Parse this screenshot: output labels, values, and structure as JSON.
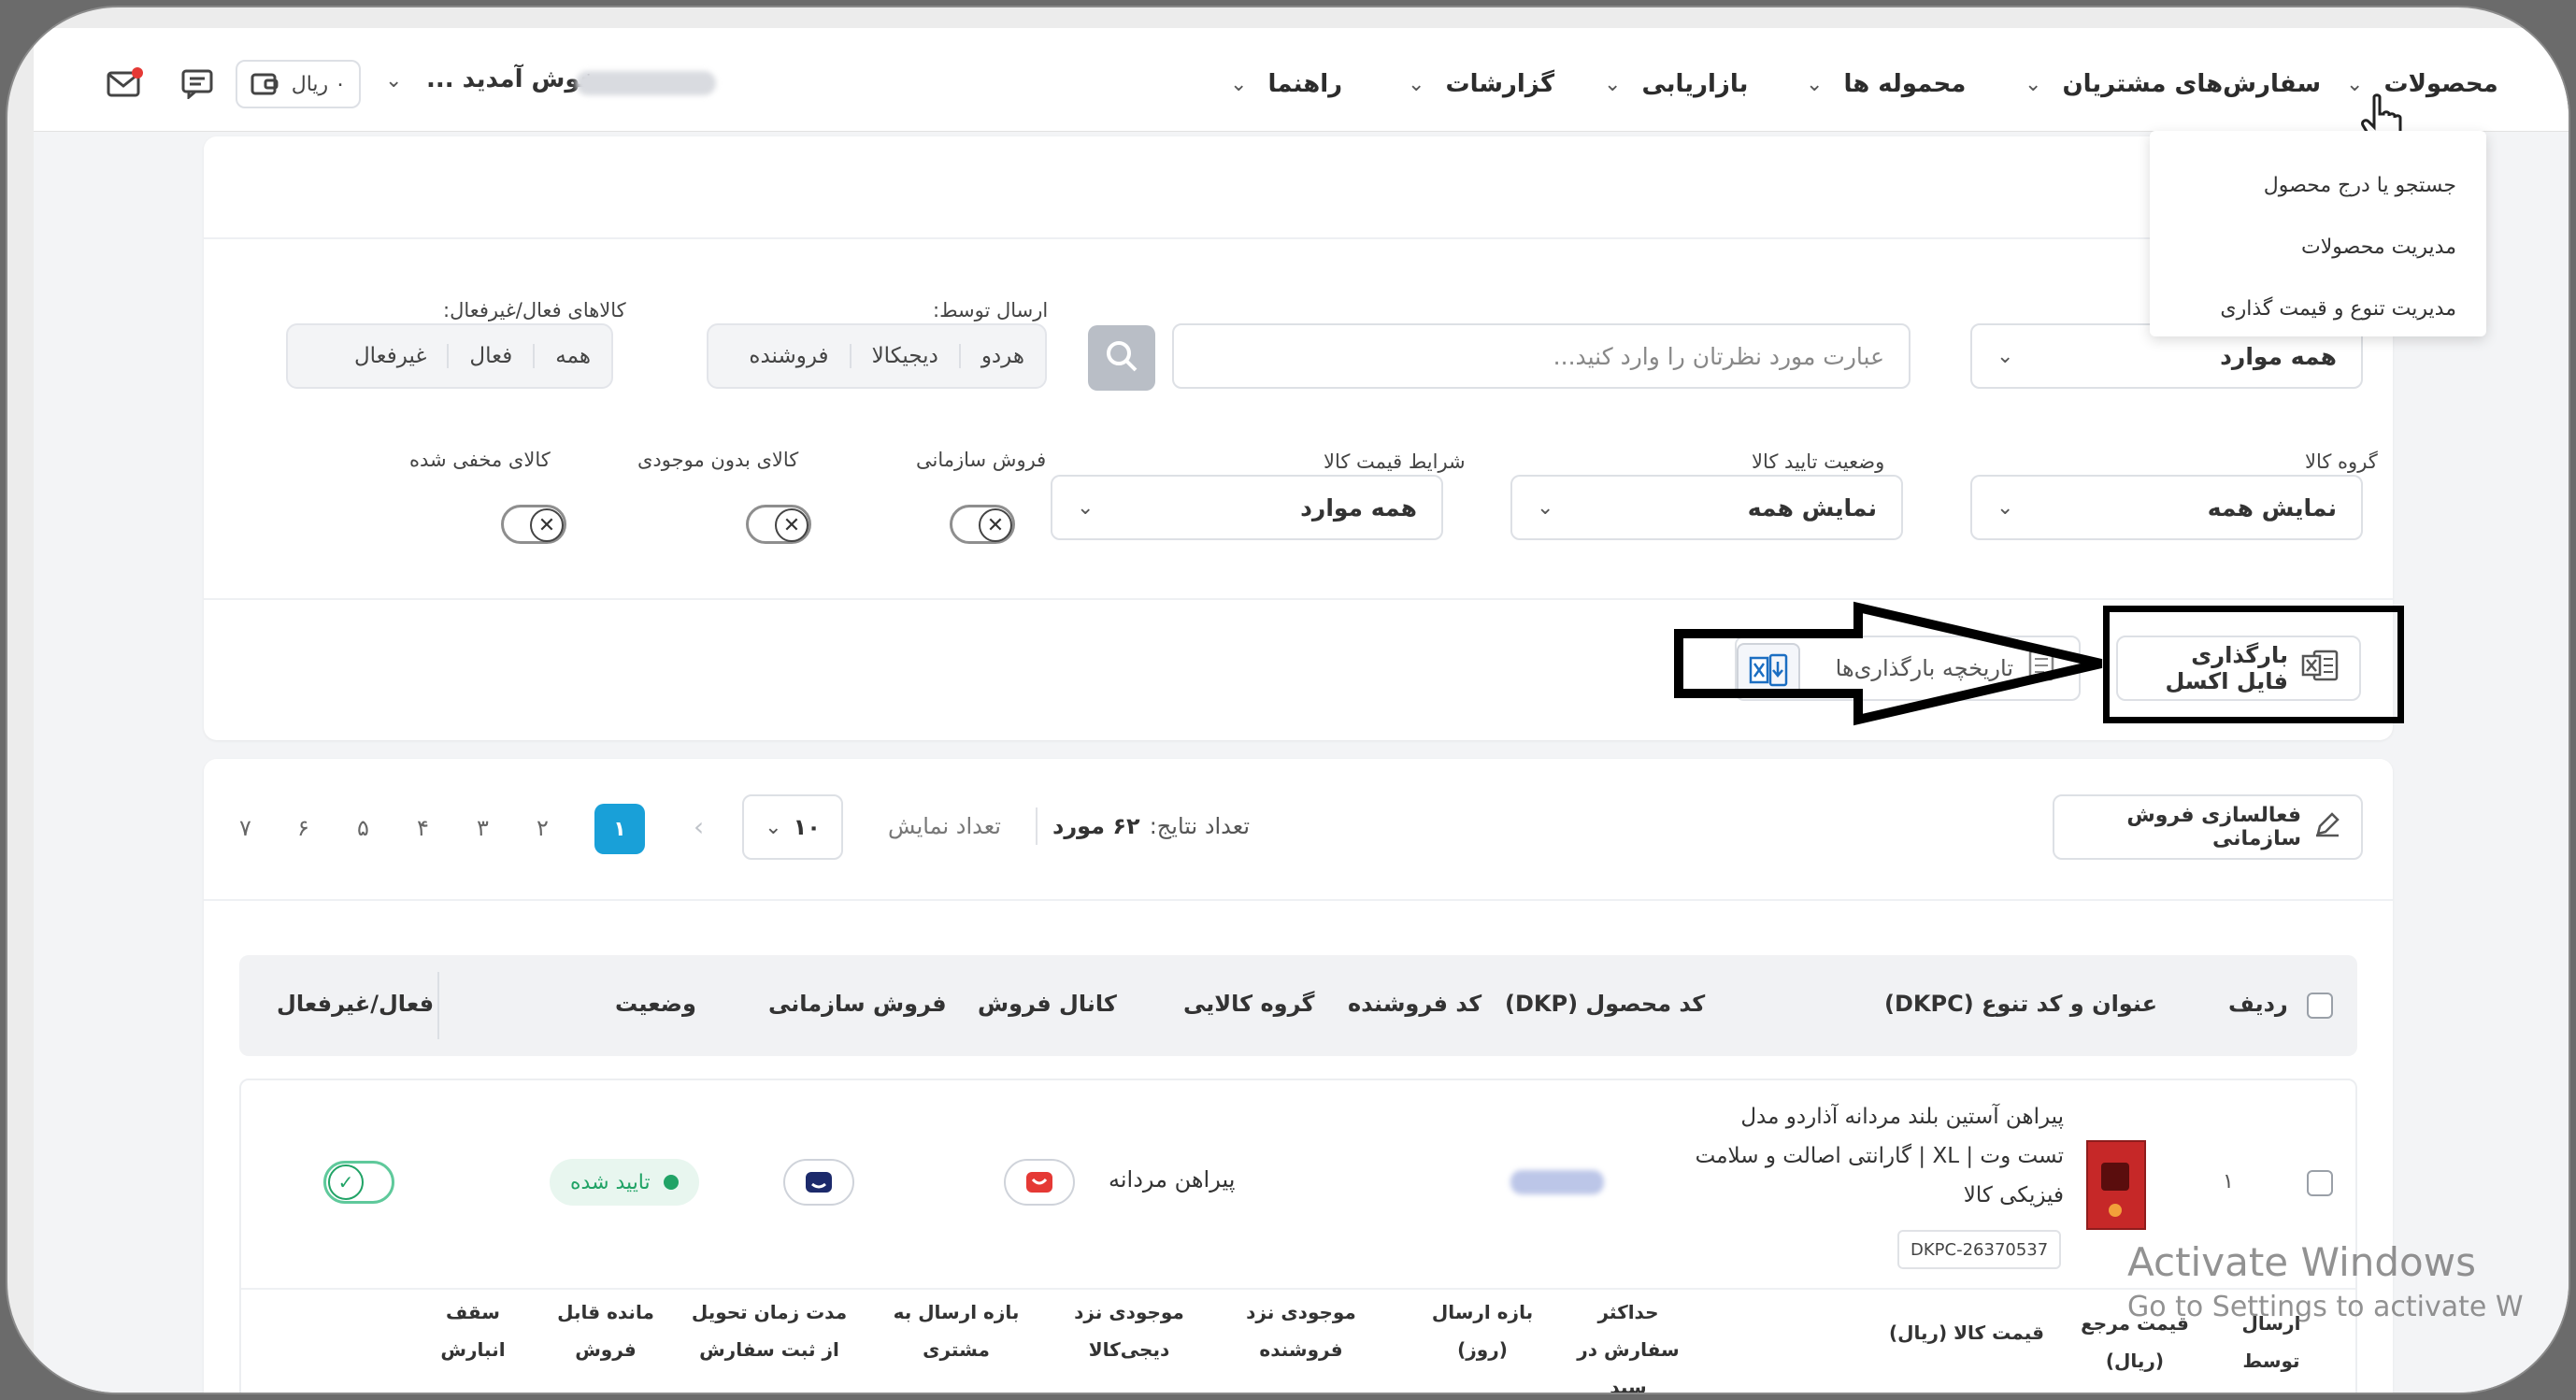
{
  "topbar": {
    "nav": [
      {
        "label": "محصولات"
      },
      {
        "label": "سفارش‌های مشتریان"
      },
      {
        "label": "محموله ها"
      },
      {
        "label": "بازاریابی"
      },
      {
        "label": "گزارشات"
      },
      {
        "label": "راهنما"
      }
    ],
    "welcome": "خوش آمدید ...",
    "balance": "۰ ریال"
  },
  "dropdown_menu": {
    "items": [
      "جستجو یا درج محصول",
      "مدیریت محصولات",
      "مدیریت تنوع و قیمت گذاری"
    ]
  },
  "filters": {
    "search_scope": "همه موارد",
    "search_placeholder": "عبارت مورد نظرتان را وارد کنید...",
    "sent_by_label": "ارسال توسط:",
    "sent_by_options": [
      "هردو",
      "دیجیکالا",
      "فروشنده"
    ],
    "active_label": "کالاهای فعال/غیرفعال:",
    "active_options": [
      "همه",
      "فعال",
      "غیرفعال"
    ],
    "product_group_label": "گروه کالا",
    "product_group_value": "نمایش همه",
    "approval_status_label": "وضعیت تایید کالا",
    "approval_status_value": "نمایش همه",
    "price_condition_label": "شرایط قیمت کالا",
    "price_condition_value": "همه موارد",
    "org_sale_label": "فروش سازمانی",
    "no_stock_label": "کالای بدون موجودی",
    "hidden_label": "کالای مخفی شده"
  },
  "actions": {
    "upload_excel": "بارگذاری فایل اکسل",
    "upload_history": "تاریخچه بارگذاری‌ها"
  },
  "results": {
    "activate_org_sale": "فعالسازی فروش سازمانی",
    "count_label": "تعداد نتایج:",
    "count_value": "۶۲ مورد",
    "per_page_label": "تعداد نمایش",
    "per_page_value": "۱۰",
    "pages": [
      "۱",
      "۲",
      "۳",
      "۴",
      "۵",
      "۶",
      "۷"
    ]
  },
  "table": {
    "headers": [
      "ردیف",
      "عنوان و کد تنوع (DKPC)",
      "کد محصول (DKP)",
      "کد فروشنده",
      "گروه کالایی",
      "کانال فروش",
      "فروش سازمانی",
      "وضعیت",
      "فعال/غیرفعال"
    ],
    "rows": [
      {
        "index": "۱",
        "title_lines": [
          "پیراهن آستین بلند مردانه آذاردو مدل",
          "تست وت | XL | گارانتی اصالت و سلامت",
          "فیزیکی کالا"
        ],
        "dkpc": "DKPC-26370537",
        "group": "پیراهن مردانه",
        "status": "تایید شده"
      }
    ],
    "sub_headers": [
      "ارسال توسط",
      "قیمت مرجع (ریال)",
      "قیمت کالا (ریال)",
      "حداکثر سفارش در سبد",
      "بازه ارسال (روز)",
      "موجودی نزد فروشنده",
      "موجودی نزد دیجی‌کالا",
      "بازه ارسال به مشتری",
      "مدت زمان تحویل از ثبت سفارش",
      "مانده قابل فروش",
      "سقف انبارش"
    ]
  },
  "watermark": {
    "line1": "Activate Windows",
    "line2": "Go to Settings to activate W"
  }
}
